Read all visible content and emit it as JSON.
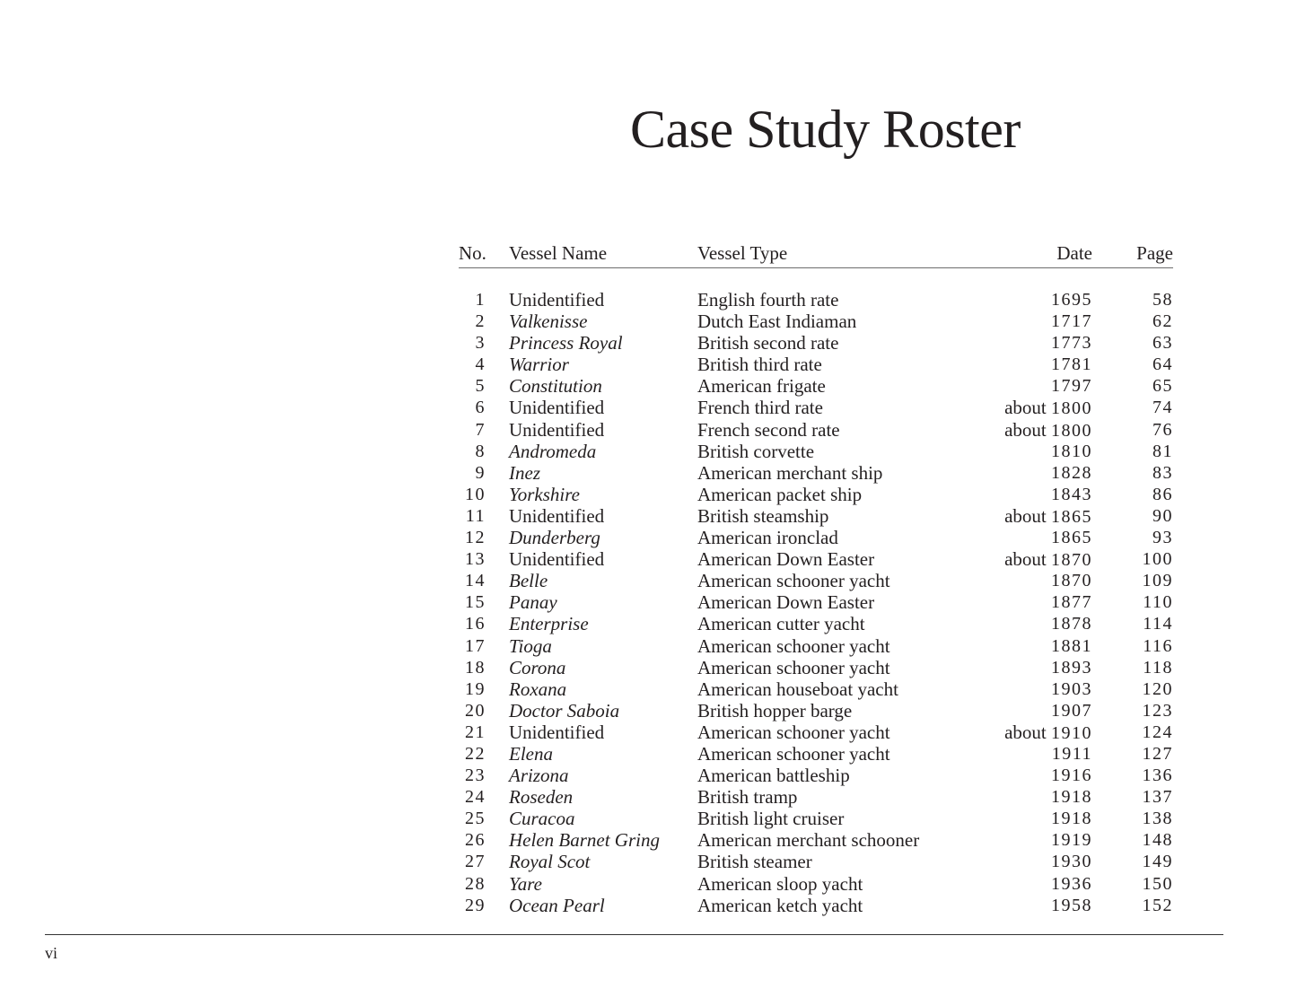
{
  "page": {
    "title": "Case Study Roster",
    "folio": "vi"
  },
  "table": {
    "headers": {
      "no": "No.",
      "name": "Vessel Name",
      "type": "Vessel Type",
      "date": "Date",
      "page": "Page"
    },
    "rows": [
      {
        "no": "1",
        "name": "Unidentified",
        "italic": false,
        "type": "English fourth rate",
        "date": "1695",
        "page": "58"
      },
      {
        "no": "2",
        "name": "Valkenisse",
        "italic": true,
        "type": "Dutch East Indiaman",
        "date": "1717",
        "page": "62"
      },
      {
        "no": "3",
        "name": "Princess Royal",
        "italic": true,
        "type": "British second rate",
        "date": "1773",
        "page": "63"
      },
      {
        "no": "4",
        "name": "Warrior",
        "italic": true,
        "type": "British third rate",
        "date": "1781",
        "page": "64"
      },
      {
        "no": "5",
        "name": "Constitution",
        "italic": true,
        "type": "American frigate",
        "date": "1797",
        "page": "65"
      },
      {
        "no": "6",
        "name": "Unidentified",
        "italic": false,
        "type": "French third rate",
        "date": "about 1800",
        "page": "74"
      },
      {
        "no": "7",
        "name": "Unidentified",
        "italic": false,
        "type": "French second rate",
        "date": "about 1800",
        "page": "76"
      },
      {
        "no": "8",
        "name": "Andromeda",
        "italic": true,
        "type": "British corvette",
        "date": "1810",
        "page": "81"
      },
      {
        "no": "9",
        "name": "Inez",
        "italic": true,
        "type": "American merchant ship",
        "date": "1828",
        "page": "83"
      },
      {
        "no": "10",
        "name": "Yorkshire",
        "italic": true,
        "type": "American packet ship",
        "date": "1843",
        "page": "86"
      },
      {
        "no": "11",
        "name": "Unidentified",
        "italic": false,
        "type": "British steamship",
        "date": "about 1865",
        "page": "90"
      },
      {
        "no": "12",
        "name": "Dunderberg",
        "italic": true,
        "type": "American ironclad",
        "date": "1865",
        "page": "93"
      },
      {
        "no": "13",
        "name": "Unidentified",
        "italic": false,
        "type": "American Down Easter",
        "date": "about 1870",
        "page": "100"
      },
      {
        "no": "14",
        "name": "Belle",
        "italic": true,
        "type": "American schooner yacht",
        "date": "1870",
        "page": "109"
      },
      {
        "no": "15",
        "name": "Panay",
        "italic": true,
        "type": "American Down Easter",
        "date": "1877",
        "page": "110"
      },
      {
        "no": "16",
        "name": "Enterprise",
        "italic": true,
        "type": "American cutter yacht",
        "date": "1878",
        "page": "114"
      },
      {
        "no": "17",
        "name": "Tioga",
        "italic": true,
        "type": "American schooner yacht",
        "date": "1881",
        "page": "116"
      },
      {
        "no": "18",
        "name": "Corona",
        "italic": true,
        "type": "American schooner yacht",
        "date": "1893",
        "page": "118"
      },
      {
        "no": "19",
        "name": "Roxana",
        "italic": true,
        "type": "American houseboat yacht",
        "date": "1903",
        "page": "120"
      },
      {
        "no": "20",
        "name": "Doctor Saboia",
        "italic": true,
        "type": "British hopper barge",
        "date": "1907",
        "page": "123"
      },
      {
        "no": "21",
        "name": "Unidentified",
        "italic": false,
        "type": "American schooner yacht",
        "date": "about 1910",
        "page": "124"
      },
      {
        "no": "22",
        "name": "Elena",
        "italic": true,
        "type": "American schooner yacht",
        "date": "1911",
        "page": "127"
      },
      {
        "no": "23",
        "name": "Arizona",
        "italic": true,
        "type": "American battleship",
        "date": "1916",
        "page": "136"
      },
      {
        "no": "24",
        "name": "Roseden",
        "italic": true,
        "type": "British tramp",
        "date": "1918",
        "page": "137"
      },
      {
        "no": "25",
        "name": "Curacoa",
        "italic": true,
        "type": "British light cruiser",
        "date": "1918",
        "page": "138"
      },
      {
        "no": "26",
        "name": "Helen Barnet Gring",
        "italic": true,
        "type": "American merchant schooner",
        "date": "1919",
        "page": "148"
      },
      {
        "no": "27",
        "name": "Royal Scot",
        "italic": true,
        "type": "British steamer",
        "date": "1930",
        "page": "149"
      },
      {
        "no": "28",
        "name": "Yare",
        "italic": true,
        "type": "American sloop yacht",
        "date": "1936",
        "page": "150"
      },
      {
        "no": "29",
        "name": "Ocean Pearl",
        "italic": true,
        "type": "American ketch yacht",
        "date": "1958",
        "page": "152"
      }
    ]
  }
}
